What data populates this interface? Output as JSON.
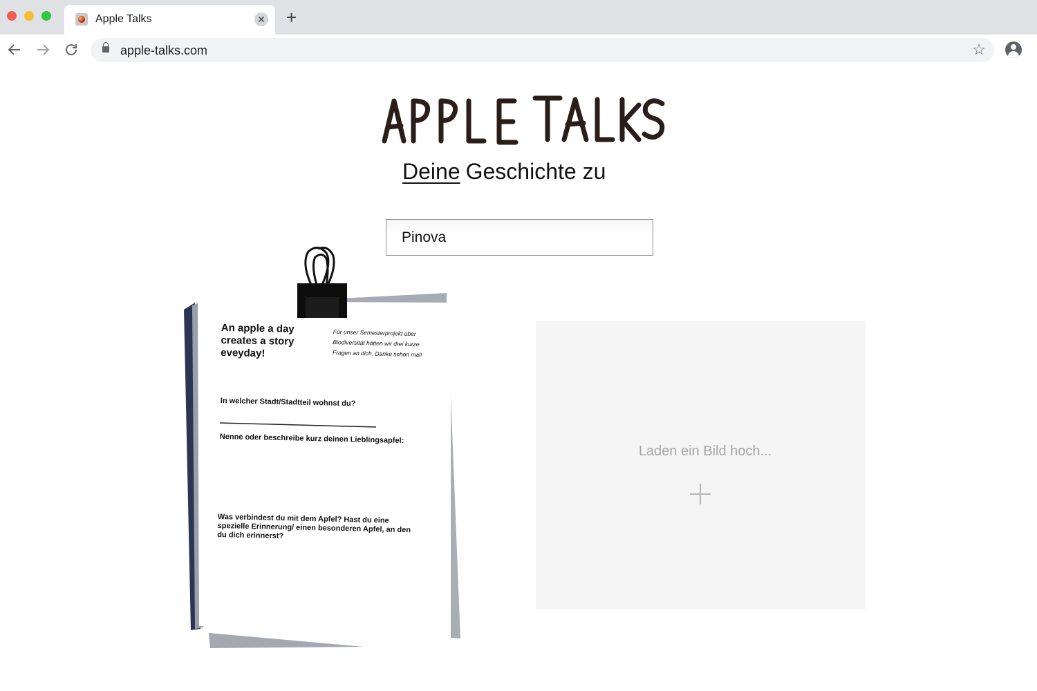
{
  "browser": {
    "tab_title": "Apple Talks",
    "tab_close_glyph": "✕",
    "new_tab_glyph": "+",
    "url": "apple-talks.com",
    "icons": [
      "back-arrow-icon",
      "forward-arrow-icon",
      "reload-icon",
      "lock-icon",
      "bookmark-star-icon",
      "profile-icon"
    ]
  },
  "page": {
    "logo_text": "APPLE TALKS",
    "subtitle_underlined": "Deine",
    "subtitle_rest": "Geschichte zu",
    "apple_input_value": "Pinova"
  },
  "questionnaire": {
    "headline": "An apple a day creates a story eveyday!",
    "intro": "Für unser Semesterprojekt über Biodiversität hätten wir drei kurze Fragen an dich. Danke schon mal!",
    "q1": "In welcher Stadt/Stadtteil wohnst du?",
    "q2": "Nenne oder beschreibe kurz deinen Lieblingsapfel:",
    "q3": "Was verbindest du mit dem Apfel? Hast du eine spezielle Erinnerung/ einen besonderen Apfel, an den du dich erinnerst?"
  },
  "upload": {
    "label": "Laden ein Bild hoch..."
  },
  "colors": {
    "tabbar": "#dfe1e5",
    "upload_bg": "#f5f5f5",
    "upload_text": "#a6a6a6",
    "logo_ink": "#2a1d1a"
  }
}
